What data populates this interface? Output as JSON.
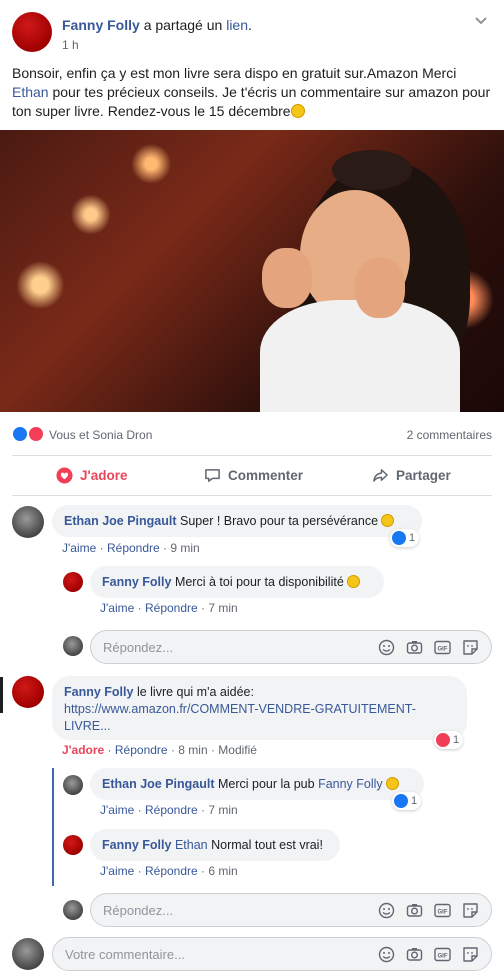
{
  "post": {
    "author": "Fanny Folly",
    "action_prefix": "a partagé un",
    "action_link": "lien",
    "action_suffix": ".",
    "time": "1 h",
    "text_part1": "Bonsoir, enfin ça y est mon livre sera dispo en gratuit sur.Amazon Merci ",
    "text_mention": "Ethan",
    "text_part2": " pour tes précieux conseils. Je t'écris un commentaire sur amazon pour ton super livre. Rendez-vous le 15 décembre"
  },
  "reactions": {
    "names": "Vous et Sonia Dron",
    "comments_count": "2 commentaires"
  },
  "actions": {
    "adore": "J'adore",
    "comment": "Commenter",
    "share": "Partager"
  },
  "comments": [
    {
      "author": "Ethan Joe Pingault",
      "text": "Super ! Bravo pour ta persévérance",
      "like": "J'aime",
      "reply": "Répondre",
      "time": "9 min",
      "reaction_count": "1",
      "replies": [
        {
          "author": "Fanny Folly",
          "text": "Merci à toi pour ta disponibilité",
          "like": "J'aime",
          "reply": "Répondre",
          "time": "7 min"
        }
      ],
      "reply_placeholder": "Répondez..."
    },
    {
      "author": "Fanny Folly",
      "text": "le livre qui m'a aidée:",
      "link": "https://www.amazon.fr/COMMENT-VENDRE-GRATUITEMENT-LIVRE...",
      "like": "J'adore",
      "reply": "Répondre",
      "time": "8 min",
      "edited": "Modifié",
      "reaction_count": "1",
      "replies": [
        {
          "author": "Ethan Joe Pingault",
          "text": "Merci pour la pub",
          "mention": "Fanny Folly",
          "like": "J'aime",
          "reply": "Répondre",
          "time": "7 min",
          "reaction_count": "1"
        },
        {
          "author": "Fanny Folly",
          "mention": "Ethan",
          "text": "Normal tout est vrai!",
          "like": "J'aime",
          "reply": "Répondre",
          "time": "6 min"
        }
      ],
      "reply_placeholder": "Répondez..."
    }
  ],
  "composer": {
    "placeholder": "Votre commentaire..."
  },
  "colors": {
    "link": "#385898",
    "love": "#e9455a",
    "like": "#1877f2",
    "bubble": "#f2f3f5"
  }
}
